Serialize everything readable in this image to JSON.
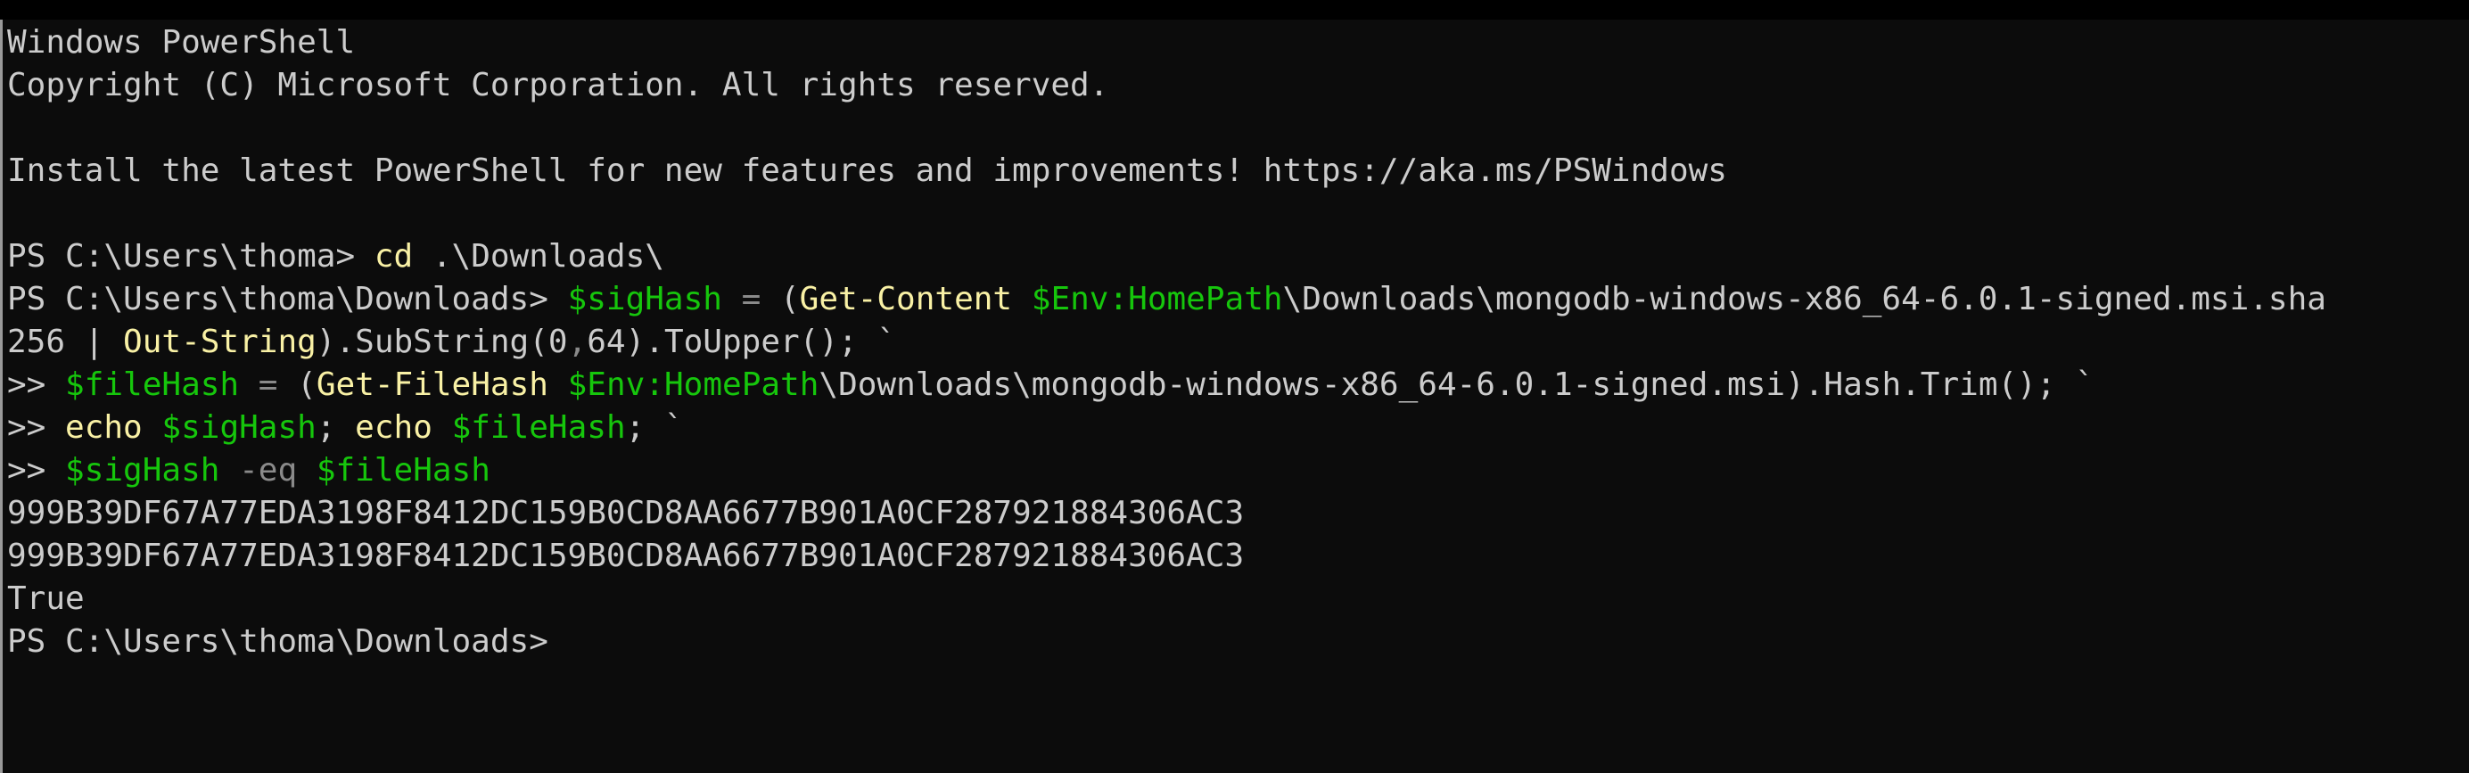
{
  "terminal": {
    "app": "Windows PowerShell",
    "colors": {
      "background": "#0c0c0c",
      "default": "#cccccc",
      "command": "#f9f1a5",
      "variable": "#16c60c",
      "operator": "#8a8a8a"
    },
    "lines": [
      {
        "segments": [
          {
            "t": "Windows PowerShell",
            "c": "fg"
          }
        ]
      },
      {
        "segments": [
          {
            "t": "Copyright (C) Microsoft Corporation. All rights reserved.",
            "c": "fg"
          }
        ]
      },
      {
        "segments": []
      },
      {
        "segments": [
          {
            "t": "Install the latest PowerShell for new features and improvements! https://aka.ms/PSWindows",
            "c": "fg"
          }
        ]
      },
      {
        "segments": []
      },
      {
        "segments": [
          {
            "t": "PS C:\\Users\\thoma> ",
            "c": "fg"
          },
          {
            "t": "cd",
            "c": "cmd"
          },
          {
            "t": " .\\Downloads\\",
            "c": "fg"
          }
        ]
      },
      {
        "segments": [
          {
            "t": "PS C:\\Users\\thoma\\Downloads> ",
            "c": "fg"
          },
          {
            "t": "$sigHash",
            "c": "var"
          },
          {
            "t": " ",
            "c": "fg"
          },
          {
            "t": "=",
            "c": "op"
          },
          {
            "t": " (",
            "c": "fg"
          },
          {
            "t": "Get-Content",
            "c": "cmd"
          },
          {
            "t": " ",
            "c": "fg"
          },
          {
            "t": "$Env:HomePath",
            "c": "var"
          },
          {
            "t": "\\Downloads\\mongodb-windows-x86_64-6.0.1-signed.msi.sha",
            "c": "fg"
          }
        ]
      },
      {
        "segments": [
          {
            "t": "256 | ",
            "c": "fg"
          },
          {
            "t": "Out-String",
            "c": "cmd"
          },
          {
            "t": ").SubString(0",
            "c": "fg"
          },
          {
            "t": ",",
            "c": "op"
          },
          {
            "t": "64).ToUpper(); `",
            "c": "fg"
          }
        ]
      },
      {
        "segments": [
          {
            "t": ">> ",
            "c": "fg"
          },
          {
            "t": "$fileHash",
            "c": "var"
          },
          {
            "t": " ",
            "c": "fg"
          },
          {
            "t": "=",
            "c": "op"
          },
          {
            "t": " (",
            "c": "fg"
          },
          {
            "t": "Get-FileHash",
            "c": "cmd"
          },
          {
            "t": " ",
            "c": "fg"
          },
          {
            "t": "$Env:HomePath",
            "c": "var"
          },
          {
            "t": "\\Downloads\\mongodb-windows-x86_64-6.0.1-signed.msi).Hash.Trim(); `",
            "c": "fg"
          }
        ]
      },
      {
        "segments": [
          {
            "t": ">> ",
            "c": "fg"
          },
          {
            "t": "echo",
            "c": "cmd"
          },
          {
            "t": " ",
            "c": "fg"
          },
          {
            "t": "$sigHash",
            "c": "var"
          },
          {
            "t": "; ",
            "c": "fg"
          },
          {
            "t": "echo",
            "c": "cmd"
          },
          {
            "t": " ",
            "c": "fg"
          },
          {
            "t": "$fileHash",
            "c": "var"
          },
          {
            "t": "; `",
            "c": "fg"
          }
        ]
      },
      {
        "segments": [
          {
            "t": ">> ",
            "c": "fg"
          },
          {
            "t": "$sigHash",
            "c": "var"
          },
          {
            "t": " ",
            "c": "fg"
          },
          {
            "t": "-eq",
            "c": "op"
          },
          {
            "t": " ",
            "c": "fg"
          },
          {
            "t": "$fileHash",
            "c": "var"
          }
        ]
      },
      {
        "segments": [
          {
            "t": "999B39DF67A77EDA3198F8412DC159B0CD8AA6677B901A0CF287921884306AC3",
            "c": "fg"
          }
        ]
      },
      {
        "segments": [
          {
            "t": "999B39DF67A77EDA3198F8412DC159B0CD8AA6677B901A0CF287921884306AC3",
            "c": "fg"
          }
        ]
      },
      {
        "segments": [
          {
            "t": "True",
            "c": "fg"
          }
        ]
      },
      {
        "segments": [
          {
            "t": "PS C:\\Users\\thoma\\Downloads>",
            "c": "fg"
          }
        ]
      }
    ]
  }
}
